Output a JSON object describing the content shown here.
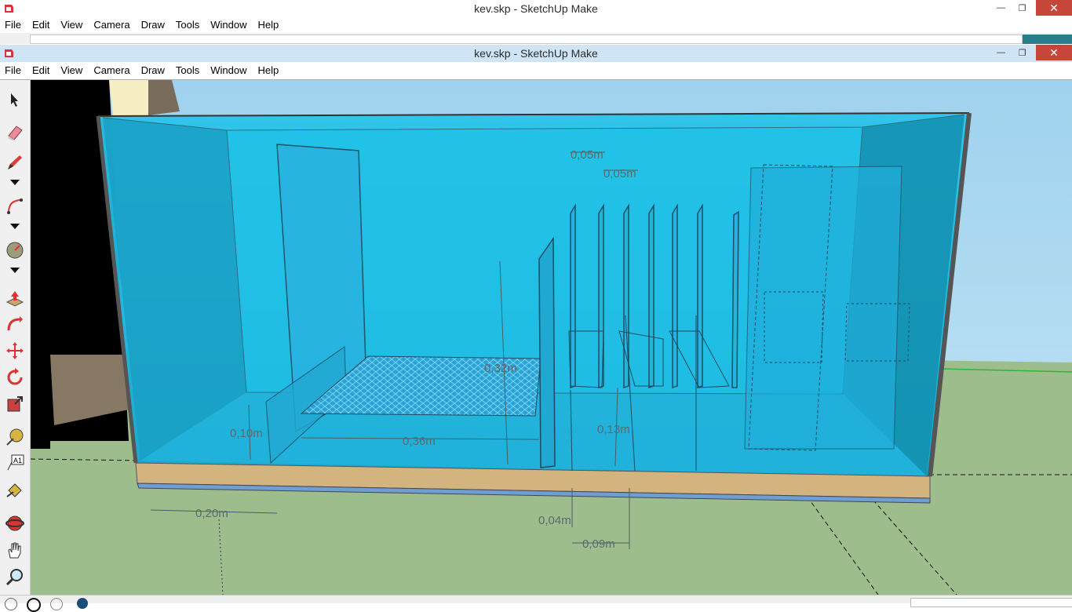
{
  "window_back": {
    "title": "kev.skp - SketchUp Make",
    "minimize": "—",
    "restore": "❐",
    "close": "✕"
  },
  "window_front": {
    "title": "kev.skp - SketchUp Make",
    "minimize": "—",
    "restore": "❐",
    "close": "✕"
  },
  "menu": [
    "File",
    "Edit",
    "View",
    "Camera",
    "Draw",
    "Tools",
    "Window",
    "Help"
  ],
  "tools": [
    "select-tool",
    "eraser-tool",
    "pencil-tool",
    "dropdown",
    "arc-tool",
    "dropdown",
    "protractor-tool",
    "dropdown",
    "push-pull-tool",
    "follow-me-tool",
    "move-tool",
    "rotate-tool",
    "scale-tool",
    "tape-measure-tool",
    "text-tool",
    "paint-bucket-tool",
    "orbit-tool",
    "pan-tool",
    "zoom-tool"
  ],
  "dimensions": {
    "d1": "0,05m",
    "d2": "0,05m",
    "d3": "0,32m",
    "d4": "0,10m",
    "d5": "0,36m",
    "d6": "0,13m",
    "d7": "0,20m",
    "d8": "0,04m",
    "d9": "0,09m"
  },
  "colors": {
    "sky": "#a9d9f2",
    "ground": "#9dbe8c",
    "water": "#1ab8e0",
    "base": "#d4b47e",
    "accent_teal": "#2a7e8c"
  }
}
